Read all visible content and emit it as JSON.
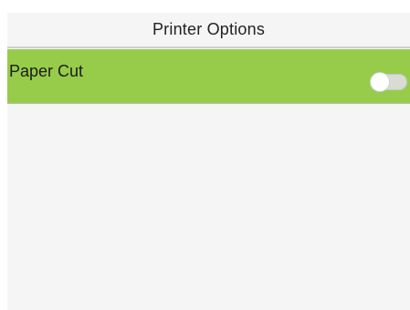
{
  "header": {
    "title": "Printer Options"
  },
  "options": [
    {
      "label": "Paper Cut",
      "enabled": false,
      "highlighted": true
    }
  ],
  "colors": {
    "highlight": "#97cc4b",
    "background": "#f5f5f5",
    "toggle_off": "#d9dcd4"
  }
}
